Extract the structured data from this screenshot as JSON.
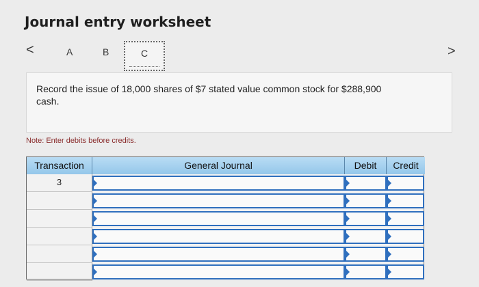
{
  "header": {
    "title": "Journal entry worksheet"
  },
  "nav": {
    "prev": "<",
    "next": ">"
  },
  "tabs": [
    {
      "label": "A"
    },
    {
      "label": "B"
    },
    {
      "label": "C",
      "selected": true
    }
  ],
  "prompt": {
    "text": "Record the issue of 18,000 shares of $7 stated value common stock for $288,900 cash."
  },
  "note": "Note: Enter debits before credits.",
  "journal": {
    "columns": {
      "transaction": "Transaction",
      "general_journal": "General Journal",
      "debit": "Debit",
      "credit": "Credit"
    },
    "rows": [
      {
        "transaction": "3",
        "account": "",
        "debit": "",
        "credit": ""
      },
      {
        "transaction": "",
        "account": "",
        "debit": "",
        "credit": ""
      },
      {
        "transaction": "",
        "account": "",
        "debit": "",
        "credit": ""
      },
      {
        "transaction": "",
        "account": "",
        "debit": "",
        "credit": ""
      },
      {
        "transaction": "",
        "account": "",
        "debit": "",
        "credit": ""
      },
      {
        "transaction": "",
        "account": "",
        "debit": "",
        "credit": ""
      }
    ]
  },
  "colors": {
    "header_blue": "#a8d3f0",
    "field_border": "#2f6fbe",
    "note_red": "#8a2c2c"
  }
}
